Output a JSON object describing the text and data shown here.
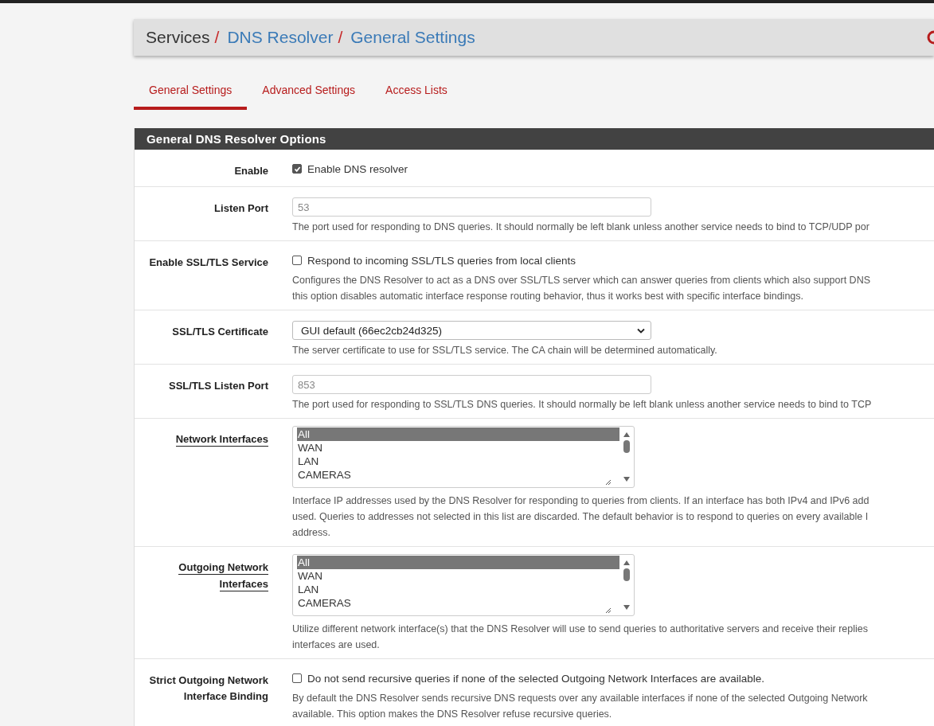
{
  "breadcrumb": [
    {
      "label": "Services",
      "link": false
    },
    {
      "separator": "/",
      "label": "DNS Resolver",
      "link": true
    },
    {
      "separator": "/",
      "label": "General Settings",
      "link": true
    }
  ],
  "tabs": [
    {
      "label": "General Settings",
      "selected": true
    },
    {
      "label": "Advanced Settings",
      "selected": false
    },
    {
      "label": "Access Lists",
      "selected": false
    }
  ],
  "panel": {
    "title": "General DNS Resolver Options",
    "rows": [
      {
        "kind": "checkbox",
        "label": [
          "Enable"
        ],
        "underlined": false,
        "checked": true,
        "text": "Enable DNS resolver",
        "help": []
      },
      {
        "kind": "input",
        "label": [
          "Listen Port"
        ],
        "underlined": false,
        "placeholder": "53",
        "help": [
          "The port used for responding to DNS queries. It should normally be left blank unless another service needs to bind to TCP/UDP por"
        ]
      },
      {
        "kind": "checkbox",
        "label": [
          "Enable SSL/TLS Service"
        ],
        "underlined": false,
        "checked": false,
        "text": "Respond to incoming SSL/TLS queries from local clients",
        "help": [
          "Configures the DNS Resolver to act as a DNS over SSL/TLS server which can answer queries from clients which also support DNS",
          "this option disables automatic interface response routing behavior, thus it works best with specific interface bindings."
        ]
      },
      {
        "kind": "select",
        "label": [
          "SSL/TLS Certificate"
        ],
        "underlined": false,
        "value": "GUI default (66ec2cb24d325)",
        "help": [
          "The server certificate to use for SSL/TLS service. The CA chain will be determined automatically."
        ]
      },
      {
        "kind": "input",
        "label": [
          "SSL/TLS Listen Port"
        ],
        "underlined": false,
        "placeholder": "853",
        "help": [
          "The port used for responding to SSL/TLS DNS queries. It should normally be left blank unless another service needs to bind to TCP"
        ]
      },
      {
        "kind": "listbox",
        "label": [
          "Network Interfaces"
        ],
        "underlined": true,
        "options": [
          {
            "label": "All",
            "selected": true
          },
          {
            "label": "WAN",
            "selected": false
          },
          {
            "label": "LAN",
            "selected": false
          },
          {
            "label": "CAMERAS",
            "selected": false
          }
        ],
        "help": [
          "Interface IP addresses used by the DNS Resolver for responding to queries from clients. If an interface has both IPv4 and IPv6 add",
          "used. Queries to addresses not selected in this list are discarded. The default behavior is to respond to queries on every available I",
          "address."
        ]
      },
      {
        "kind": "listbox",
        "label": [
          "Outgoing Network",
          "Interfaces"
        ],
        "underlined": true,
        "options": [
          {
            "label": "All",
            "selected": true
          },
          {
            "label": "WAN",
            "selected": false
          },
          {
            "label": "LAN",
            "selected": false
          },
          {
            "label": "CAMERAS",
            "selected": false
          }
        ],
        "help": [
          "Utilize different network interface(s) that the DNS Resolver will use to send queries to authoritative servers and receive their replies",
          "interfaces are used."
        ]
      },
      {
        "kind": "checkbox",
        "label": [
          "Strict Outgoing Network",
          "Interface Binding"
        ],
        "underlined": false,
        "checked": false,
        "text": "Do not send recursive queries if none of the selected Outgoing Network Interfaces are available.",
        "help": [
          "By default the DNS Resolver sends recursive DNS requests over any available interfaces if none of the selected Outgoing Network",
          "available. This option makes the DNS Resolver refuse recursive queries."
        ]
      }
    ]
  }
}
